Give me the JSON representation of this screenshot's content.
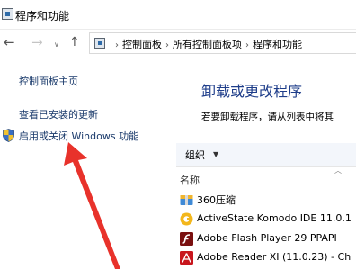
{
  "window": {
    "title": "程序和功能"
  },
  "nav": {
    "back": "←",
    "forward": "→",
    "recent": "∨",
    "up": "↑"
  },
  "breadcrumb": [
    "控制面板",
    "所有控制面板项",
    "程序和功能"
  ],
  "left_panel": {
    "home": "控制面板主页",
    "updates": "查看已安装的更新",
    "features": "启用或关闭 Windows 功能"
  },
  "main": {
    "heading": "卸载或更改程序",
    "description": "若要卸载程序，请从列表中将其"
  },
  "toolbar": {
    "organize": "组织"
  },
  "table": {
    "column_name": "名称",
    "rows": [
      {
        "name": "360压缩",
        "icon": "archive-icon"
      },
      {
        "name": "ActiveState Komodo IDE 11.0.1",
        "icon": "komodo-icon"
      },
      {
        "name": "Adobe Flash Player 29 PPAPI",
        "icon": "flash-icon"
      },
      {
        "name": "Adobe Reader XI (11.0.23) - Ch",
        "icon": "acrobat-icon"
      }
    ]
  },
  "colors": {
    "heading": "#1e3d8a",
    "link": "#1a3a6b",
    "annotation_arrow": "#e8322b",
    "toolbar_bg": "#f3f6fb"
  }
}
